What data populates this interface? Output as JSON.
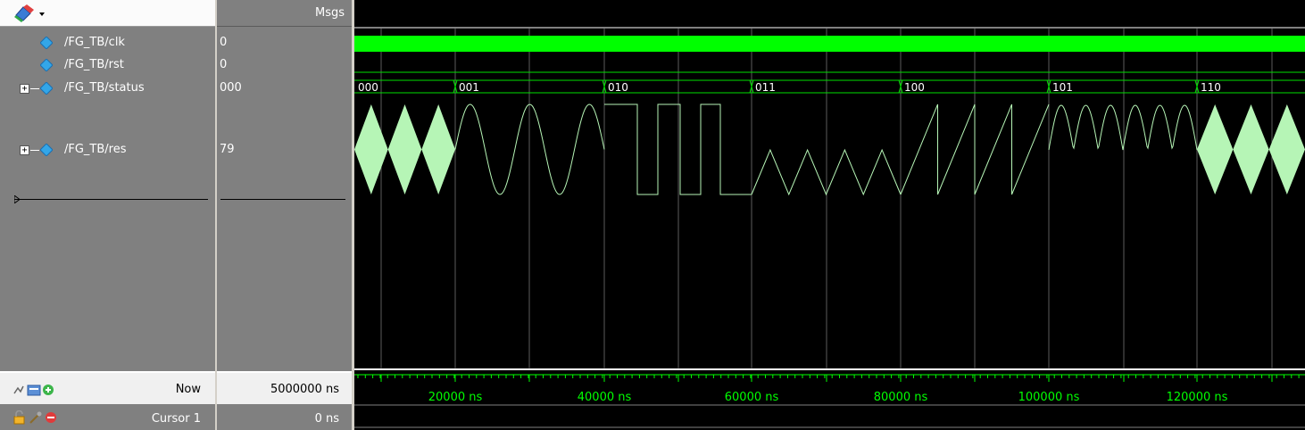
{
  "header": {
    "msgs_label": "Msgs"
  },
  "signals": [
    {
      "name": "/FG_TB/clk",
      "value": "0",
      "expandable": false
    },
    {
      "name": "/FG_TB/rst",
      "value": "0",
      "expandable": false
    },
    {
      "name": "/FG_TB/status",
      "value": "000",
      "expandable": true
    },
    {
      "name": "/FG_TB/res",
      "value": "79",
      "expandable": true
    }
  ],
  "expander_symbol": "+",
  "status_segments": [
    "000",
    "001",
    "010",
    "011",
    "100",
    "101",
    "110"
  ],
  "footer": {
    "now_label": "Now",
    "now_value": "5000000 ns",
    "cursor_label": "Cursor 1",
    "cursor_value": "0 ns"
  },
  "time_ticks": [
    "20000 ns",
    "40000 ns",
    "60000 ns",
    "80000 ns",
    "100000 ns",
    "120000 ns"
  ],
  "colors": {
    "clk": "#00ff00",
    "bus": "#00e000",
    "analog": "#b6f5b6",
    "grid": "#ffffff",
    "cursor_line": "#c0c0c0",
    "time_text": "#00ff00"
  }
}
